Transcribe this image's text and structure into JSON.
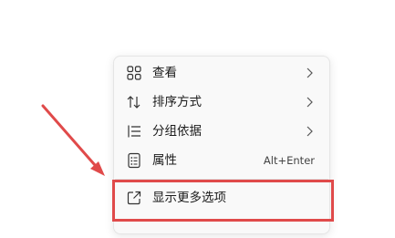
{
  "context_menu": {
    "items": [
      {
        "label": "查看",
        "icon": "view-grid-icon",
        "has_submenu": true
      },
      {
        "label": "排序方式",
        "icon": "sort-arrows-icon",
        "has_submenu": true
      },
      {
        "label": "分组依据",
        "icon": "group-list-icon",
        "has_submenu": true
      },
      {
        "label": "属性",
        "icon": "properties-icon",
        "shortcut": "Alt+Enter"
      },
      {
        "label": "显示更多选项",
        "icon": "external-link-icon"
      }
    ]
  },
  "annotation": {
    "highlight_color": "#e04a4a",
    "arrow_color": "#e04a4a"
  }
}
